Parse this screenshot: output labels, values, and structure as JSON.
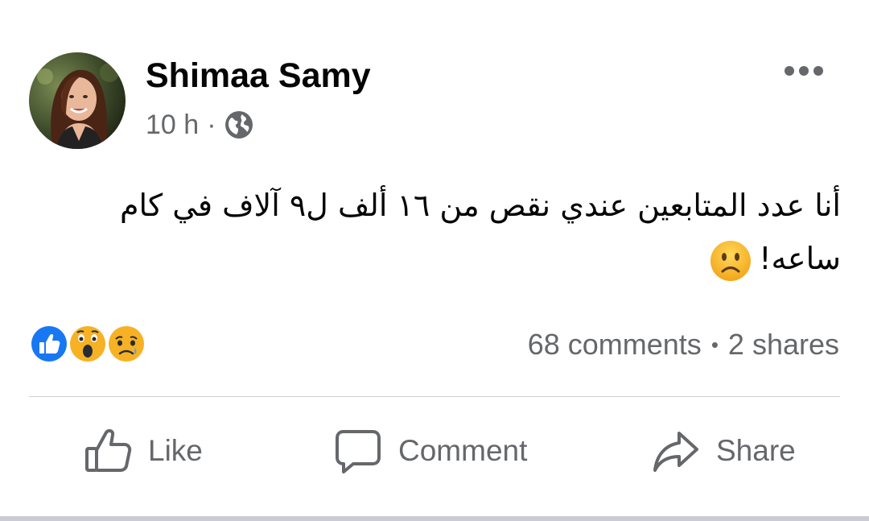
{
  "author": {
    "name": "Shimaa Samy",
    "avatar_icon": "profile-photo"
  },
  "meta": {
    "time": "10 h",
    "separator": "·",
    "privacy_icon": "globe-icon"
  },
  "post": {
    "text": "أنا عدد المتابعين عندي نقص من ١٦ ألف ل٩ آلاف في كام ساعه!",
    "emoji_icon": "slightly-frowning-face-emoji"
  },
  "reactions": {
    "icons": [
      "like-reaction-icon",
      "wow-reaction-icon",
      "sad-reaction-icon"
    ],
    "colors": {
      "like": "#1877f2",
      "emoji": "#f7b125"
    }
  },
  "stats": {
    "comments": "68 comments",
    "bullet": "•",
    "shares": "2 shares"
  },
  "actions": {
    "like": "Like",
    "comment": "Comment",
    "share": "Share"
  },
  "colors": {
    "primary_text": "#050505",
    "secondary_text": "#65676b",
    "divider": "#ced0d4",
    "background": "#ffffff"
  }
}
